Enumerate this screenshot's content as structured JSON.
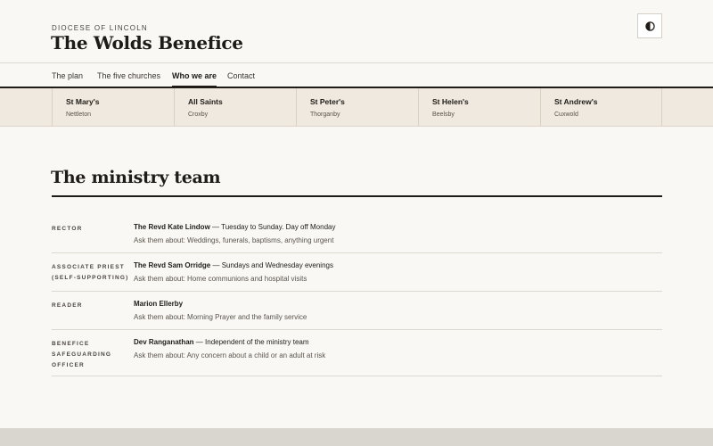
{
  "header": {
    "diocese": "DIOCESE OF LINCOLN",
    "title": "The Wolds Benefice",
    "theme_toggle_icon": "contrast-icon"
  },
  "nav": {
    "items": [
      {
        "label": "The plan"
      },
      {
        "label": "The five churches"
      },
      {
        "label": "Who we are",
        "active": true
      },
      {
        "label": "Contact"
      }
    ]
  },
  "churches": [
    {
      "name": "St Mary's",
      "village": "Nettleton"
    },
    {
      "name": "All Saints",
      "village": "Croxby"
    },
    {
      "name": "St Peter's",
      "village": "Thorganby"
    },
    {
      "name": "St Helen's",
      "village": "Beelsby"
    },
    {
      "name": "St Andrew's",
      "village": "Cuxwold"
    }
  ],
  "team": {
    "title": "The ministry team",
    "members": [
      {
        "role": "RECTOR",
        "name": "The Revd Kate Lindow",
        "availability": " — Tuesday to Sunday. Day off Monday",
        "ask": "Ask them about: Weddings, funerals, baptisms, anything urgent"
      },
      {
        "role": "ASSOCIATE PRIEST (SELF-SUPPORTING)",
        "name": "The Revd Sam Orridge",
        "availability": " — Sundays and Wednesday evenings",
        "ask": "Ask them about: Home communions and hospital visits"
      },
      {
        "role": "READER",
        "name": "Marion Ellerby",
        "availability": "",
        "ask": "Ask them about: Morning Prayer and the family service"
      },
      {
        "role": "BENEFICE SAFEGUARDING OFFICER",
        "name": "Dev Ranganathan",
        "availability": " — Independent of the ministry team",
        "ask": "Ask them about: Any concern about a child or an adult at risk"
      }
    ]
  },
  "colors": {
    "background": "#faf8f5",
    "ink": "#1f1c18",
    "church_band": "#efe9df",
    "footer_band": "#d9d6d0"
  }
}
